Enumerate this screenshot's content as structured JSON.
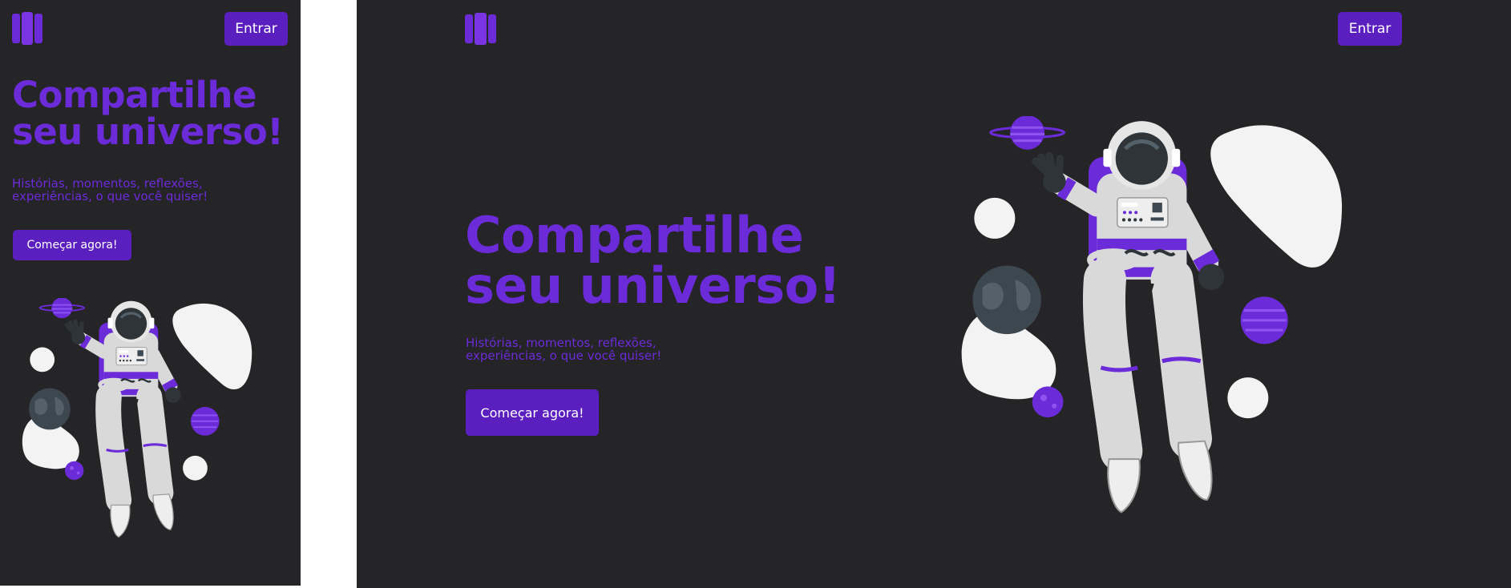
{
  "brand": {
    "logo_icon": "stacked-books-icon",
    "accent": "#6c2bd9",
    "button_bg": "#5b1fbf",
    "background": "#252527"
  },
  "header": {
    "login_label": "Entrar"
  },
  "hero": {
    "title_line1": "Compartilhe",
    "title_line2": "seu universo!",
    "subtitle_line1": "Histórias, momentos, reflexões,",
    "subtitle_line2": "experiências, o que você quiser!",
    "cta_label": "Começar agora!"
  },
  "illustration": {
    "icon": "astronaut-illustration"
  }
}
